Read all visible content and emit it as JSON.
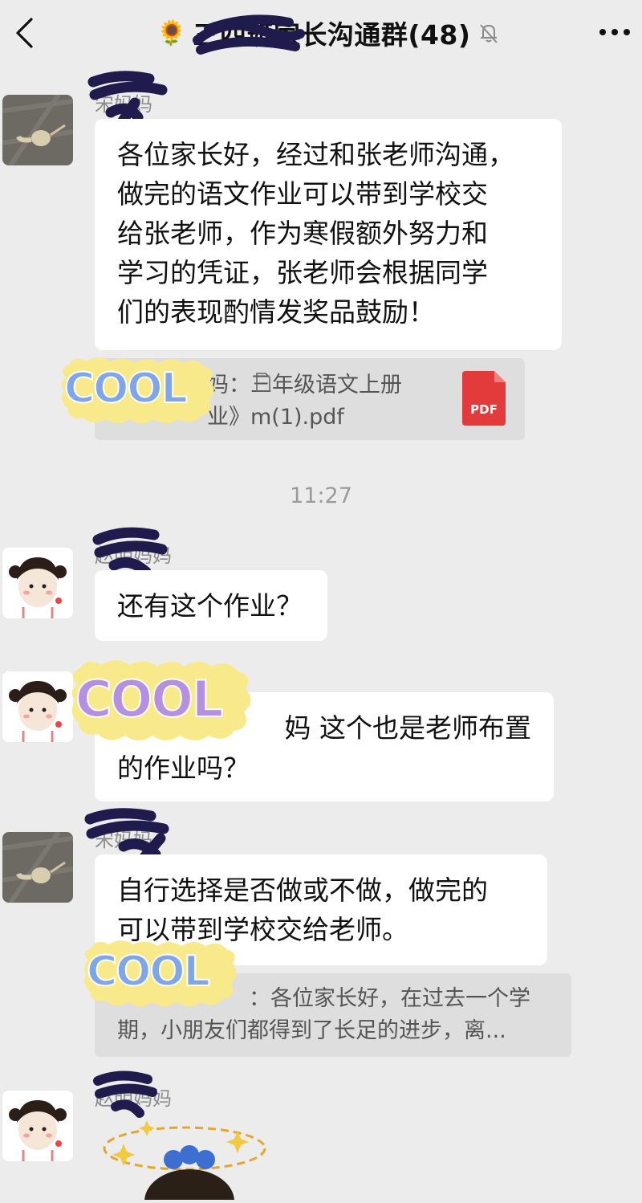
{
  "header": {
    "title": "三四班家长沟通群(48)",
    "sunflower": "🌻"
  },
  "timestamp": "11:27",
  "sticker_text": "COOL",
  "messages": {
    "m1": {
      "sender": "宋妈妈",
      "lines": [
        "各位家长好，经过和张老师沟通，",
        "做完的语文作业可以带到学校交",
        "给张老师，作为寒假额外努力和",
        "学习的凭证，张老师会根据同学",
        "们的表现酌情发奖品鼓励！"
      ],
      "quote_line1": "妈：三年级语文上册",
      "quote_line2": "业》m(1).pdf",
      "pdf_label": "PDF"
    },
    "m2": {
      "sender": "赵明妈妈",
      "text": "还有这个作业？"
    },
    "m3": {
      "line1": "妈 这个也是老师布置",
      "line2": "的作业吗？"
    },
    "m4": {
      "sender": "宋妈妈",
      "lines": [
        "自行选择是否做或不做，做完的",
        "可以带到学校交给老师。"
      ],
      "quote_line1": "：各位家长好，在过去一个学",
      "quote_line2": "期，小朋友们都得到了长足的进步，离..."
    },
    "m5": {
      "sender": "赵明妈妈"
    }
  }
}
